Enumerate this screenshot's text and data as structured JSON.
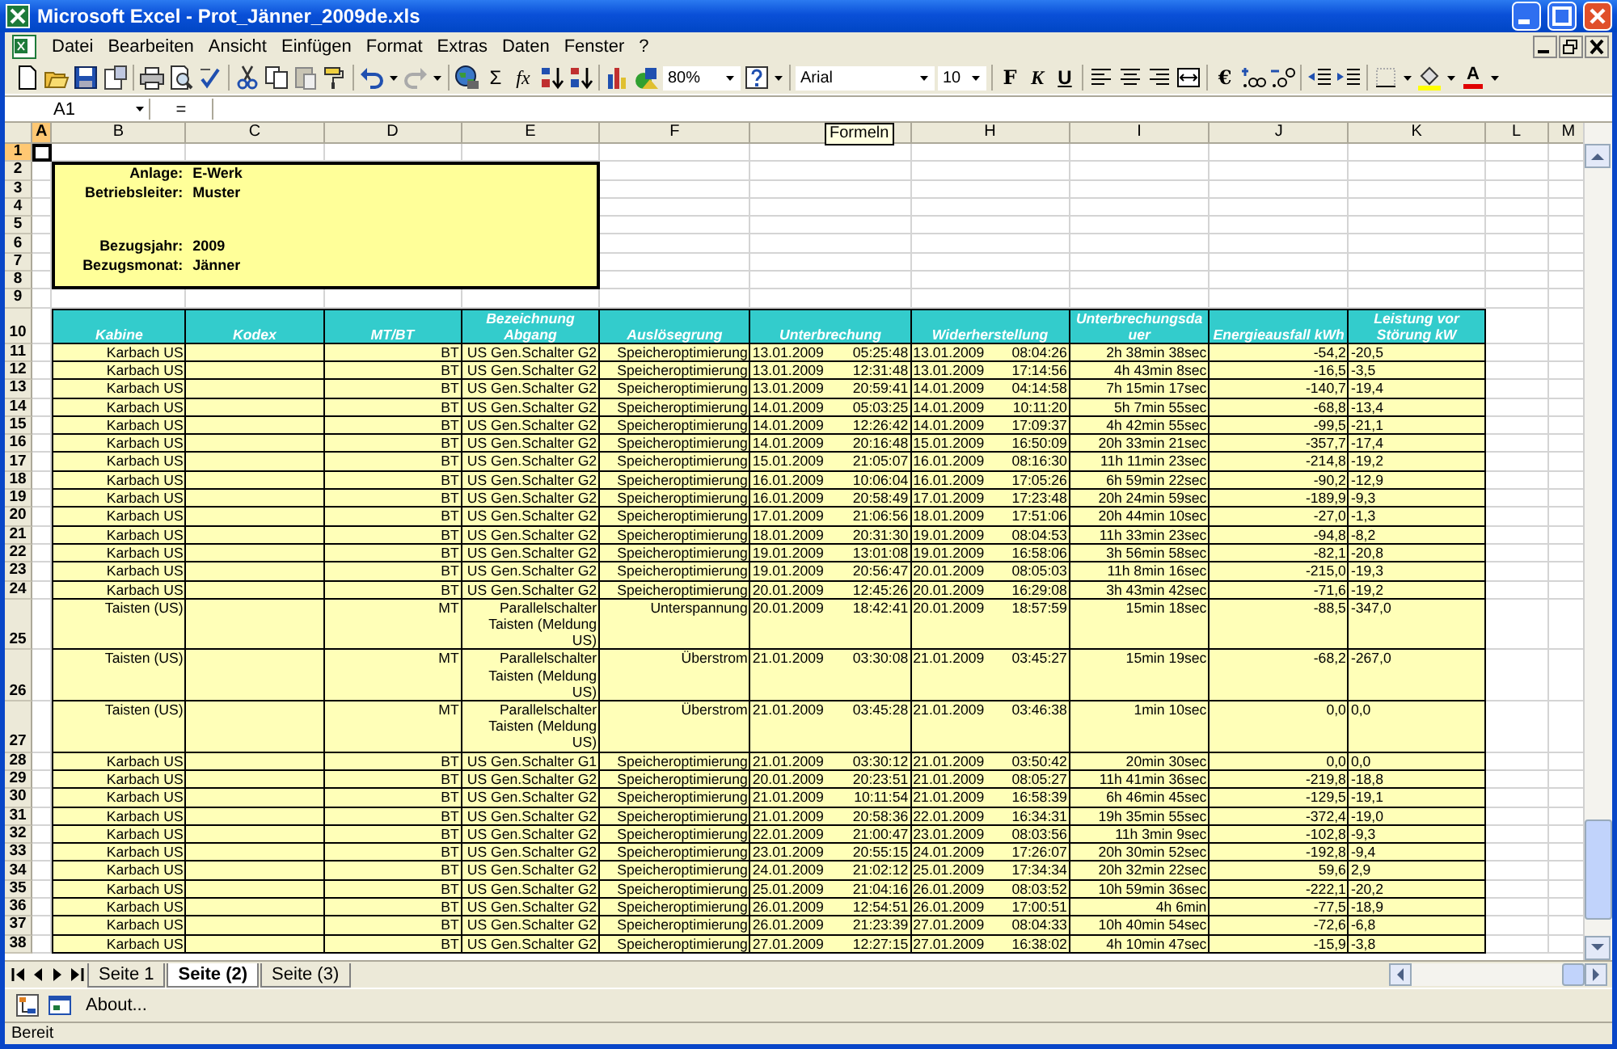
{
  "window": {
    "title": "Microsoft Excel - Prot_Jänner_2009de.xls"
  },
  "menu": [
    "Datei",
    "Bearbeiten",
    "Ansicht",
    "Einfügen",
    "Format",
    "Extras",
    "Daten",
    "Fenster",
    "?"
  ],
  "toolbar": {
    "sum": "Σ",
    "function": "fx",
    "zoom": "80%",
    "font": "Arial",
    "font_size": "10",
    "bold": "F",
    "italic": "K",
    "underline": "U",
    "currency": "€",
    "font_color": "A"
  },
  "formula_bar": {
    "name_box": "A1",
    "equals": "="
  },
  "tooltip": "Formeln",
  "columns": [
    {
      "label": "A",
      "selected": true
    },
    {
      "label": "B",
      "selected": false
    },
    {
      "label": "C",
      "selected": false
    },
    {
      "label": "D",
      "selected": false
    },
    {
      "label": "E",
      "selected": false
    },
    {
      "label": "F",
      "selected": false
    },
    {
      "selected": false
    },
    {
      "label": "H",
      "selected": false
    },
    {
      "label": "I",
      "selected": false
    },
    {
      "label": "J",
      "selected": false
    },
    {
      "label": "K",
      "selected": false
    },
    {
      "label": "L",
      "selected": false
    },
    {
      "label": "M",
      "selected": false
    }
  ],
  "grid_rows": [
    {
      "label": "1",
      "selected": true
    },
    {
      "label": "2",
      "selected": false
    },
    {
      "label": "3",
      "selected": false
    },
    {
      "label": "4",
      "selected": false
    },
    {
      "label": "5",
      "selected": false
    },
    {
      "label": "6",
      "selected": false
    },
    {
      "label": "7",
      "selected": false
    },
    {
      "label": "8",
      "selected": false
    },
    {
      "label": "9",
      "selected": false
    }
  ],
  "info": [
    [
      {
        "label": "Anlage:",
        "value": "E-Werk"
      },
      {
        "label": "Betriebsleiter:",
        "value": "Muster"
      }
    ],
    [
      {
        "label": "Bezugsjahr:",
        "value": "2009"
      },
      {
        "label": "Bezugsmonat:",
        "value": "Jänner"
      }
    ]
  ],
  "table": {
    "header_row": "10",
    "headers": [
      "Kabine",
      "Kodex",
      "MT/BT",
      "Bezeichnung Abgang",
      "Auslösegrung",
      "Unterbrechung",
      "Widerherstellung",
      "Unterbrechungsdauer",
      "Energieausfall kWh",
      "Leistung vor Störung kW"
    ],
    "rows": [
      {
        "row": "11",
        "cells": [
          "Karbach US",
          "BT",
          "US Gen.Schalter G2",
          "Speicheroptimierung",
          "13.01.2009 05:25:48",
          "13.01.2009 08:04:26",
          "2h 38min 38sec",
          "-54,2",
          "-20,5"
        ]
      },
      {
        "row": "12",
        "cells": [
          "Karbach US",
          "BT",
          "US Gen.Schalter G2",
          "Speicheroptimierung",
          "13.01.2009 12:31:48",
          "13.01.2009 17:14:56",
          "4h 43min 8sec",
          "-16,5",
          "-3,5"
        ]
      },
      {
        "row": "13",
        "cells": [
          "Karbach US",
          "BT",
          "US Gen.Schalter G2",
          "Speicheroptimierung",
          "13.01.2009 20:59:41",
          "14.01.2009 04:14:58",
          "7h 15min 17sec",
          "-140,7",
          "-19,4"
        ]
      },
      {
        "row": "14",
        "cells": [
          "Karbach US",
          "BT",
          "US Gen.Schalter G2",
          "Speicheroptimierung",
          "14.01.2009 05:03:25",
          "14.01.2009 10:11:20",
          "5h 7min 55sec",
          "-68,8",
          "-13,4"
        ]
      },
      {
        "row": "15",
        "cells": [
          "Karbach US",
          "BT",
          "US Gen.Schalter G2",
          "Speicheroptimierung",
          "14.01.2009 12:26:42",
          "14.01.2009 17:09:37",
          "4h 42min 55sec",
          "-99,5",
          "-21,1"
        ]
      },
      {
        "row": "16",
        "cells": [
          "Karbach US",
          "BT",
          "US Gen.Schalter G2",
          "Speicheroptimierung",
          "14.01.2009 20:16:48",
          "15.01.2009 16:50:09",
          "20h 33min 21sec",
          "-357,7",
          "-17,4"
        ]
      },
      {
        "row": "17",
        "cells": [
          "Karbach US",
          "BT",
          "US Gen.Schalter G2",
          "Speicheroptimierung",
          "15.01.2009 21:05:07",
          "16.01.2009 08:16:30",
          "11h 11min 23sec",
          "-214,8",
          "-19,2"
        ]
      },
      {
        "row": "18",
        "cells": [
          "Karbach US",
          "BT",
          "US Gen.Schalter G2",
          "Speicheroptimierung",
          "16.01.2009 10:06:04",
          "16.01.2009 17:05:26",
          "6h 59min 22sec",
          "-90,2",
          "-12,9"
        ]
      },
      {
        "row": "19",
        "cells": [
          "Karbach US",
          "BT",
          "US Gen.Schalter G2",
          "Speicheroptimierung",
          "16.01.2009 20:58:49",
          "17.01.2009 17:23:48",
          "20h 24min 59sec",
          "-189,9",
          "-9,3"
        ]
      },
      {
        "row": "20",
        "cells": [
          "Karbach US",
          "BT",
          "US Gen.Schalter G2",
          "Speicheroptimierung",
          "17.01.2009 21:06:56",
          "18.01.2009 17:51:06",
          "20h 44min 10sec",
          "-27,0",
          "-1,3"
        ]
      },
      {
        "row": "21",
        "cells": [
          "Karbach US",
          "BT",
          "US Gen.Schalter G2",
          "Speicheroptimierung",
          "18.01.2009 20:31:30",
          "19.01.2009 08:04:53",
          "11h 33min 23sec",
          "-94,8",
          "-8,2"
        ]
      },
      {
        "row": "22",
        "cells": [
          "Karbach US",
          "BT",
          "US Gen.Schalter G2",
          "Speicheroptimierung",
          "19.01.2009 13:01:08",
          "19.01.2009 16:58:06",
          "3h 56min 58sec",
          "-82,1",
          "-20,8"
        ]
      },
      {
        "row": "23",
        "cells": [
          "Karbach US",
          "BT",
          "US Gen.Schalter G2",
          "Speicheroptimierung",
          "19.01.2009 20:56:47",
          "20.01.2009 08:05:03",
          "11h 8min 16sec",
          "-215,0",
          "-19,3"
        ]
      },
      {
        "row": "24",
        "cells": [
          "Karbach US",
          "BT",
          "US Gen.Schalter G2",
          "Speicheroptimierung",
          "20.01.2009 12:45:26",
          "20.01.2009 16:29:08",
          "3h 43min 42sec",
          "-71,6",
          "-19,2"
        ]
      },
      {
        "row": "25",
        "cells": [
          "Taisten (US)",
          "MT",
          "Parallelschalter Taisten (Meldung US)",
          "Unterspannung",
          "20.01.2009 18:42:41",
          "20.01.2009 18:57:59",
          "15min 18sec",
          "-88,5",
          "-347,0"
        ]
      },
      {
        "row": "26",
        "cells": [
          "Taisten (US)",
          "MT",
          "Parallelschalter Taisten (Meldung US)",
          "Überstrom",
          "21.01.2009 03:30:08",
          "21.01.2009 03:45:27",
          "15min 19sec",
          "-68,2",
          "-267,0"
        ]
      },
      {
        "row": "27",
        "cells": [
          "Taisten (US)",
          "MT",
          "Parallelschalter Taisten (Meldung US)",
          "Überstrom",
          "21.01.2009 03:45:28",
          "21.01.2009 03:46:38",
          "1min 10sec",
          "0,0",
          "0,0"
        ]
      },
      {
        "row": "28",
        "cells": [
          "Karbach US",
          "BT",
          "US Gen.Schalter G1",
          "Speicheroptimierung",
          "21.01.2009 03:30:12",
          "21.01.2009 03:50:42",
          "20min 30sec",
          "0,0",
          "0,0"
        ]
      },
      {
        "row": "29",
        "cells": [
          "Karbach US",
          "BT",
          "US Gen.Schalter G2",
          "Speicheroptimierung",
          "20.01.2009 20:23:51",
          "21.01.2009 08:05:27",
          "11h 41min 36sec",
          "-219,8",
          "-18,8"
        ]
      },
      {
        "row": "30",
        "cells": [
          "Karbach US",
          "BT",
          "US Gen.Schalter G2",
          "Speicheroptimierung",
          "21.01.2009 10:11:54",
          "21.01.2009 16:58:39",
          "6h 46min 45sec",
          "-129,5",
          "-19,1"
        ]
      },
      {
        "row": "31",
        "cells": [
          "Karbach US",
          "BT",
          "US Gen.Schalter G2",
          "Speicheroptimierung",
          "21.01.2009 20:58:36",
          "22.01.2009 16:34:31",
          "19h 35min 55sec",
          "-372,4",
          "-19,0"
        ]
      },
      {
        "row": "32",
        "cells": [
          "Karbach US",
          "BT",
          "US Gen.Schalter G2",
          "Speicheroptimierung",
          "22.01.2009 21:00:47",
          "23.01.2009 08:03:56",
          "11h 3min 9sec",
          "-102,8",
          "-9,3"
        ]
      },
      {
        "row": "33",
        "cells": [
          "Karbach US",
          "BT",
          "US Gen.Schalter G2",
          "Speicheroptimierung",
          "23.01.2009 20:55:15",
          "24.01.2009 17:26:07",
          "20h 30min 52sec",
          "-192,8",
          "-9,4"
        ]
      },
      {
        "row": "34",
        "cells": [
          "Karbach US",
          "BT",
          "US Gen.Schalter G2",
          "Speicheroptimierung",
          "24.01.2009 21:02:12",
          "25.01.2009 17:34:34",
          "20h 32min 22sec",
          "59,6",
          "2,9"
        ]
      },
      {
        "row": "35",
        "cells": [
          "Karbach US",
          "BT",
          "US Gen.Schalter G2",
          "Speicheroptimierung",
          "25.01.2009 21:04:16",
          "26.01.2009 08:03:52",
          "10h 59min 36sec",
          "-222,1",
          "-20,2"
        ]
      },
      {
        "row": "36",
        "cells": [
          "Karbach US",
          "BT",
          "US Gen.Schalter G2",
          "Speicheroptimierung",
          "26.01.2009 12:54:51",
          "26.01.2009 17:00:51",
          "4h 6min",
          "-77,5",
          "-18,9"
        ]
      },
      {
        "row": "37",
        "cells": [
          "Karbach US",
          "BT",
          "US Gen.Schalter G2",
          "Speicheroptimierung",
          "26.01.2009 21:23:39",
          "27.01.2009 08:04:33",
          "10h 40min 54sec",
          "-72,6",
          "-6,8"
        ]
      },
      {
        "row": "38",
        "cells": [
          "Karbach US",
          "BT",
          "US Gen.Schalter G2",
          "Speicheroptimierung",
          "27.01.2009 12:27:15",
          "27.01.2009 16:38:02",
          "4h 10min 47sec",
          "-15,9",
          "-3,8"
        ]
      }
    ]
  },
  "sheet_tabs": [
    {
      "label": "Seite 1",
      "selected": false
    },
    {
      "label": "Seite (2)",
      "selected": true
    },
    {
      "label": "Seite (3)",
      "selected": false
    }
  ],
  "drawing_toolbar": {
    "button": "About..."
  },
  "status_bar": {
    "text": "Bereit"
  }
}
